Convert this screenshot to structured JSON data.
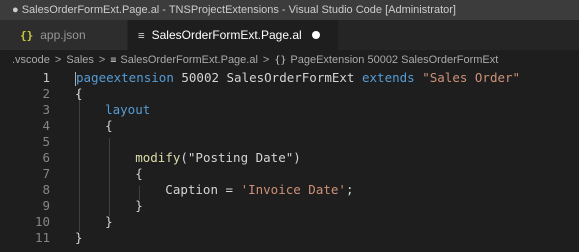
{
  "window": {
    "title": "● SalesOrderFormExt.Page.al - TNSProjectExtensions - Visual Studio Code [Administrator]"
  },
  "tabs": [
    {
      "icon": "{}",
      "label": "app.json"
    },
    {
      "icon": "≡",
      "label": "SalesOrderFormExt.Page.al"
    }
  ],
  "breadcrumb": {
    "items": [
      ".vscode",
      "Sales",
      "SalesOrderFormExt.Page.al",
      "PageExtension 50002 SalesOrderFormExt"
    ],
    "separator": ">"
  },
  "editor": {
    "lines": [
      {
        "n": "1",
        "t": [
          [
            "p",
            ""
          ],
          [
            "kw",
            "ageextension"
          ],
          [
            "",
            " 50002 SalesOrderFormExt "
          ],
          [
            "kw",
            "extends"
          ],
          [
            "",
            " "
          ],
          [
            "str",
            "\"Sales Order\""
          ]
        ]
      },
      {
        "n": "2",
        "t": [
          [
            "",
            "{"
          ]
        ]
      },
      {
        "n": "3",
        "t": [
          [
            "",
            "    "
          ],
          [
            "kw",
            "layout"
          ]
        ]
      },
      {
        "n": "4",
        "t": [
          [
            "",
            "    {"
          ]
        ]
      },
      {
        "n": "5",
        "t": []
      },
      {
        "n": "6",
        "t": [
          [
            "",
            "        "
          ],
          [
            "fn",
            "modify"
          ],
          [
            "",
            "(\"Posting Date\")"
          ]
        ]
      },
      {
        "n": "7",
        "t": [
          [
            "",
            "        {"
          ]
        ]
      },
      {
        "n": "8",
        "t": [
          [
            "",
            "            Caption = "
          ],
          [
            "str",
            "'Invoice Date'"
          ],
          [
            "",
            ";"
          ]
        ]
      },
      {
        "n": "9",
        "t": [
          [
            "",
            "        }"
          ]
        ]
      },
      {
        "n": "10",
        "t": [
          [
            "",
            "    }"
          ]
        ]
      },
      {
        "n": "11",
        "t": [
          [
            "",
            "}"
          ]
        ]
      }
    ]
  },
  "colors": {
    "keyword": "#569cd6",
    "string": "#ce9178",
    "function": "#dcdcaa",
    "text": "#d4d4d4",
    "background": "#1e1e1e"
  }
}
